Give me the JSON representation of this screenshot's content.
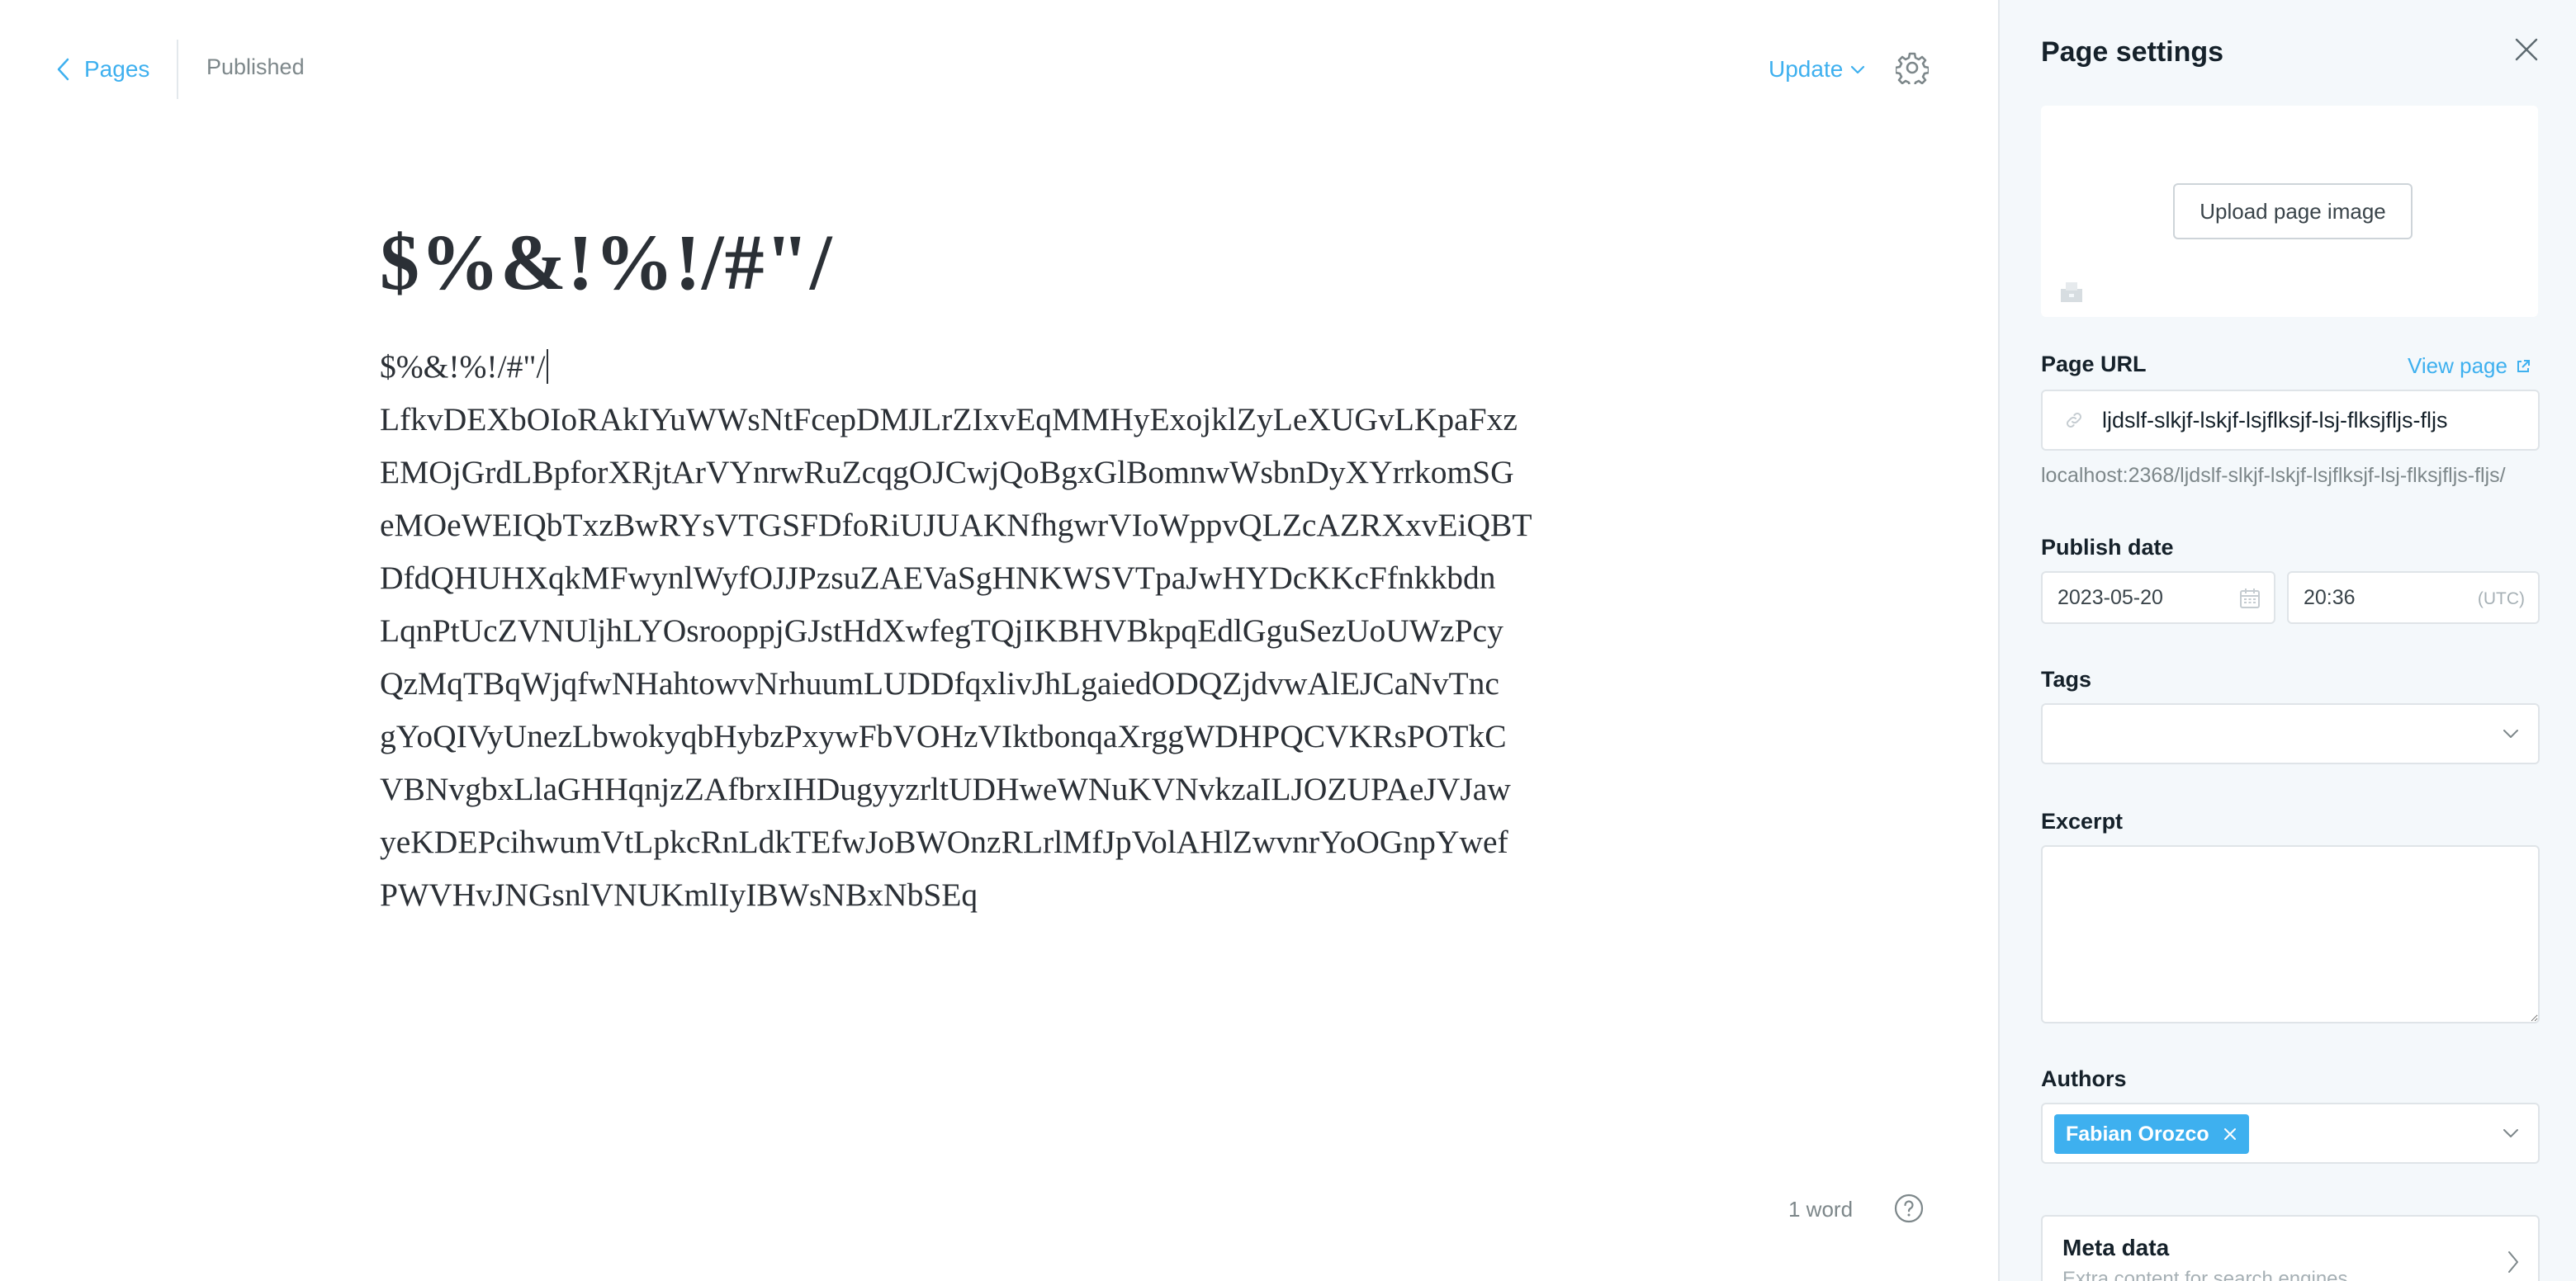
{
  "header": {
    "back_label": "Pages",
    "status": "Published",
    "update_label": "Update"
  },
  "editor": {
    "title": "$%&!%!/#\"/",
    "body_lines": [
      "$%&!%!/#\"/",
      "LfkvDEXbOIoRAkIYuWWsNtFcepDMJLrZIxvEqMMHyExojklZyLeXUGvLKpaFxz",
      "EMOjGrdLBpforXRjtArVYnrwRuZcqgOJCwjQoBgxGlBomnwWsbnDyXYrrkomSG",
      "eMOeWEIQbTxzBwRYsVTGSFDfoRiUJUAKNfhgwrVIoWppvQLZcAZRXxvEiQBT",
      "DfdQHUHXqkMFwynlWyfOJJPzsuZAEVaSgHNKWSVTpaJwHYDcKKcFfnkkbdn",
      "LqnPtUcZVNUljhLYOsrooppjGJstHdXwfegTQjIKBHVBkpqEdlGguSezUoUWzPcy",
      "QzMqTBqWjqfwNHahtowvNrhuumLUDDfqxlivJhLgaiedODQZjdvwAlEJCaNvTnc",
      "gYoQIVyUnezLbwokyqbHybzPxywFbVOHzVIktbonqaXrggWDHPQCVKRsPOTkC",
      "VBNvgbxLlaGHHqnjzZAfbrxIHDugyyzrltUDHweWNuKVNvkzaILJOZUPAeJVJaw",
      "yeKDEPcihwumVtLpkcRnLdkTEfwJoBWOnzRLrlMfJpVolAHlZwvnrYoOGnpYwef",
      "PWVHvJNGsnlVNUKmlIyIBWsNBxNbSEq"
    ],
    "word_count": "1 word"
  },
  "settings": {
    "title": "Page settings",
    "upload_label": "Upload page image",
    "page_url_label": "Page URL",
    "view_page_label": "View page",
    "slug_value": "ljdslf-slkjf-lskjf-lsjflksjf-lsj-flksjfljs-fljs",
    "url_hint": "localhost:2368/ljdslf-slkjf-lskjf-lsjflksjf-lsj-flksjfljs-fljs/",
    "publish_date_label": "Publish date",
    "date_value": "2023-05-20",
    "time_value": "20:36",
    "timezone": "(UTC)",
    "tags_label": "Tags",
    "excerpt_label": "Excerpt",
    "authors_label": "Authors",
    "author_name": "Fabian Orozco",
    "meta_title": "Meta data",
    "meta_sub": "Extra content for search engines"
  },
  "colors": {
    "accent": "#3eb0ef",
    "panel_bg": "#f4f8fb"
  }
}
